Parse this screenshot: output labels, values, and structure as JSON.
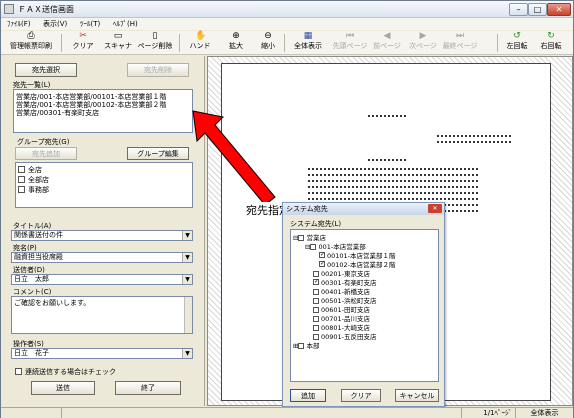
{
  "window": {
    "title": "ＦＡＸ送信画面",
    "minimize_glyph": "–",
    "maximize_glyph": "□",
    "close_glyph": "✕"
  },
  "menu": [
    {
      "label": "ﾌｧｲﾙ(F)"
    },
    {
      "label": "表示(V)"
    },
    {
      "label": "ﾂｰﾙ(T)"
    },
    {
      "label": "ﾍﾙﾌﾟ(H)"
    }
  ],
  "toolbar": [
    {
      "label": "管理帳票印刷",
      "icon": "printer-icon",
      "glyph": "⎙",
      "enabled": true
    },
    {
      "label": "クリア",
      "icon": "scissors-icon",
      "glyph": "✂",
      "enabled": true
    },
    {
      "label": "スキャナ",
      "icon": "scanner-icon",
      "glyph": "▭",
      "enabled": true
    },
    {
      "label": "ページ削除",
      "icon": "delete-page-icon",
      "glyph": "▯",
      "enabled": true
    },
    {
      "label": "ハンド",
      "icon": "hand-icon",
      "glyph": "✋",
      "enabled": true
    },
    {
      "label": "拡大",
      "icon": "zoom-in-icon",
      "glyph": "⊕",
      "enabled": true
    },
    {
      "label": "縮小",
      "icon": "zoom-out-icon",
      "glyph": "⊖",
      "enabled": true
    },
    {
      "label": "全体表示",
      "icon": "fit-page-icon",
      "glyph": "▦",
      "enabled": true
    },
    {
      "label": "先頭ページ",
      "icon": "first-page-icon",
      "glyph": "⏮",
      "enabled": false
    },
    {
      "label": "前ページ",
      "icon": "prev-page-icon",
      "glyph": "◀",
      "enabled": false
    },
    {
      "label": "次ページ",
      "icon": "next-page-icon",
      "glyph": "▶",
      "enabled": false
    },
    {
      "label": "最終ページ",
      "icon": "last-page-icon",
      "glyph": "⏭",
      "enabled": false
    },
    {
      "label": "左回転",
      "icon": "rotate-left-icon",
      "glyph": "↺",
      "enabled": true
    },
    {
      "label": "右回転",
      "icon": "rotate-right-icon",
      "glyph": "↻",
      "enabled": true
    }
  ],
  "recipients": {
    "select_button": "宛先選択",
    "delete_button": "宛先削除",
    "list_label": "宛先一覧(L)",
    "items": [
      "営業店/001-本店営業部/00101-本店営業部１階",
      "営業店/001-本店営業部/00102-本店営業部２階",
      "営業店/00301-有楽町支店"
    ]
  },
  "groups": {
    "label": "グループ宛先(G)",
    "add_button": "宛先追加",
    "edit_button": "グループ編集",
    "items": [
      "全店",
      "全部店",
      "事務部"
    ]
  },
  "form": {
    "title_label": "タイトル(A)",
    "title_value": "関係書送付の件",
    "addressee_label": "宛名(P)",
    "addressee_value": "融資担当役席殿",
    "sender_label": "送信者(D)",
    "sender_value": "日立　太郎",
    "comment_label": "コメント(C)",
    "comment_value": "ご確認をお願いします。",
    "operator_label": "操作者(S)",
    "operator_value": "日立　花子",
    "continuous_label": "連続送信する場合はチェック",
    "send_button": "送信",
    "exit_button": "終了"
  },
  "annotation": {
    "label": "宛先指定",
    "arrow_color": "#ff0000"
  },
  "dialog": {
    "title": "システム宛先",
    "list_label": "システム宛先(L)",
    "tree": [
      {
        "text": "営業店",
        "level": 0,
        "expander": "⊟",
        "checked": false
      },
      {
        "text": "001-本店営業部",
        "level": 1,
        "expander": "⊟",
        "checked": false
      },
      {
        "text": "00101-本店営業部１階",
        "level": 2,
        "expander": "",
        "checked": true
      },
      {
        "text": "00102-本店営業部２階",
        "level": 2,
        "expander": "",
        "checked": true
      },
      {
        "text": "00201-東京支店",
        "level": 1,
        "expander": "",
        "checked": false
      },
      {
        "text": "00301-有楽町支店",
        "level": 1,
        "expander": "",
        "checked": true
      },
      {
        "text": "00401-新橋支店",
        "level": 1,
        "expander": "",
        "checked": false
      },
      {
        "text": "00501-浜松町支店",
        "level": 1,
        "expander": "",
        "checked": false
      },
      {
        "text": "00601-田町支店",
        "level": 1,
        "expander": "",
        "checked": false
      },
      {
        "text": "00701-品川支店",
        "level": 1,
        "expander": "",
        "checked": false
      },
      {
        "text": "00801-大崎支店",
        "level": 1,
        "expander": "",
        "checked": false
      },
      {
        "text": "00901-五反田支店",
        "level": 1,
        "expander": "",
        "checked": false
      },
      {
        "text": "本部",
        "level": 0,
        "expander": "⊞",
        "checked": false
      }
    ],
    "add_button": "追加",
    "clear_button": "クリア",
    "cancel_button": "キャンセル",
    "close_glyph": "✕"
  },
  "status": {
    "page_indicator": "1/1ﾍﾟｰｼﾞ",
    "view_mode": "全体表示"
  }
}
